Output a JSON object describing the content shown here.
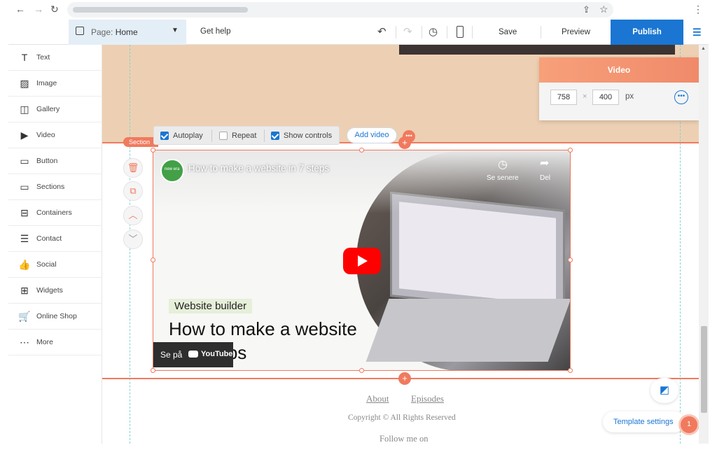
{
  "browser": {
    "back": "←",
    "forward": "→",
    "reload": "↻",
    "share": "⇪",
    "star": "☆",
    "menu": "⋮"
  },
  "topbar": {
    "page_label": "Page:",
    "page_name": "Home",
    "get_help": "Get help",
    "save": "Save",
    "preview": "Preview",
    "publish": "Publish"
  },
  "sidebar": {
    "items": [
      {
        "label": "Text",
        "icon": "T"
      },
      {
        "label": "Image",
        "icon": "▨"
      },
      {
        "label": "Gallery",
        "icon": "◫"
      },
      {
        "label": "Video",
        "icon": "▶"
      },
      {
        "label": "Button",
        "icon": "▭"
      },
      {
        "label": "Sections",
        "icon": "▭"
      },
      {
        "label": "Containers",
        "icon": "⊟"
      },
      {
        "label": "Contact",
        "icon": "☰"
      },
      {
        "label": "Social",
        "icon": "👍"
      },
      {
        "label": "Widgets",
        "icon": "⊞"
      },
      {
        "label": "Online Shop",
        "icon": "🛒"
      },
      {
        "label": "More",
        "icon": "⋯"
      }
    ]
  },
  "video_toolbar": {
    "autoplay": "Autoplay",
    "repeat": "Repeat",
    "show_controls": "Show controls",
    "add_video": "Add video",
    "section_tag": "Section"
  },
  "video_panel": {
    "title": "Video",
    "width": "758",
    "height": "400",
    "unit": "px",
    "x_sep": "×"
  },
  "video": {
    "channel_badge": "new era",
    "title": "How to make a website in 7 steps",
    "watch_later": "Se senere",
    "share": "Del",
    "badge": "Website builder",
    "big_title": "How to make a website in 7 steps",
    "watch_on": "Se på",
    "youtube": "YouTube"
  },
  "footer": {
    "about": "About",
    "episodes": "Episodes",
    "copyright": "Copyright © All Rights Reserved",
    "follow": "Follow me on"
  },
  "floating": {
    "template_settings": "Template settings",
    "badge_count": "1"
  },
  "colors": {
    "accent": "#1a76d2",
    "section": "#f07a5e",
    "tan": "#edd0b3"
  }
}
